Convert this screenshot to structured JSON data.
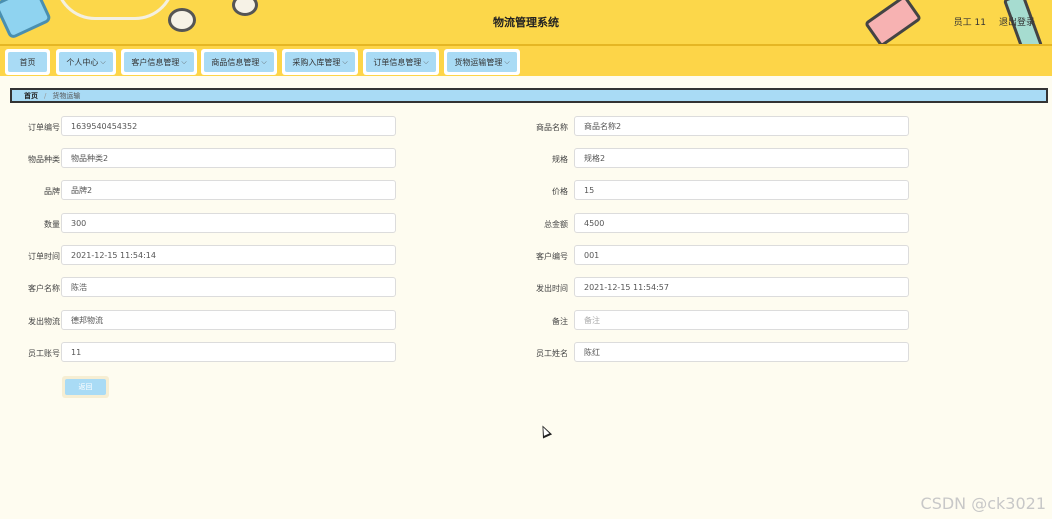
{
  "header": {
    "title": "物流管理系统",
    "user": "员工 11",
    "logout": "退出登录"
  },
  "nav": [
    {
      "label": "首页",
      "has_menu": false
    },
    {
      "label": "个人中心",
      "has_menu": true
    },
    {
      "label": "客户信息管理",
      "has_menu": true
    },
    {
      "label": "商品信息管理",
      "has_menu": true
    },
    {
      "label": "采购入库管理",
      "has_menu": true
    },
    {
      "label": "订单信息管理",
      "has_menu": true
    },
    {
      "label": "货物运输管理",
      "has_menu": true
    }
  ],
  "breadcrumb": {
    "home": "首页",
    "current": "货物运输"
  },
  "form": {
    "left": [
      {
        "label": "订单编号",
        "value": "1639540454352"
      },
      {
        "label": "物品种类",
        "value": "物品种类2"
      },
      {
        "label": "品牌",
        "value": "品牌2"
      },
      {
        "label": "数量",
        "value": "300"
      },
      {
        "label": "订单时间",
        "value": "2021-12-15 11:54:14"
      },
      {
        "label": "客户名称",
        "value": "陈浩"
      },
      {
        "label": "发出物流",
        "value": "德邦物流"
      },
      {
        "label": "员工账号",
        "value": "11"
      }
    ],
    "right": [
      {
        "label": "商品名称",
        "value": "商品名称2"
      },
      {
        "label": "规格",
        "value": "规格2"
      },
      {
        "label": "价格",
        "value": "15"
      },
      {
        "label": "总金额",
        "value": "4500"
      },
      {
        "label": "客户编号",
        "value": "001"
      },
      {
        "label": "发出时间",
        "value": "2021-12-15 11:54:57"
      },
      {
        "label": "备注",
        "value": "",
        "placeholder": "备注"
      },
      {
        "label": "员工姓名",
        "value": "陈红"
      }
    ]
  },
  "back_button": "返回",
  "watermark": "CSDN @ck3021"
}
